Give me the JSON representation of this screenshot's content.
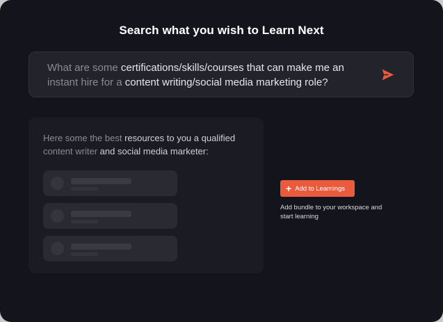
{
  "title": "Search what you wish to Learn Next",
  "search": {
    "query_segments": [
      {
        "text": "What are some ",
        "muted": true
      },
      {
        "text": "certifications/skills/courses that can make me an",
        "muted": false
      },
      {
        "text": " instant hire for a ",
        "muted": true
      },
      {
        "text": "content writing/social media marketing role?",
        "muted": false
      }
    ],
    "send_icon": "send-icon",
    "accent_color": "#ea5b3e"
  },
  "result": {
    "text_segments": [
      {
        "text": "Here some the best ",
        "muted": true
      },
      {
        "text": "resources to you a qualified",
        "muted": false
      },
      {
        "text": " content writer ",
        "muted": true
      },
      {
        "text": "and social media marketer:",
        "muted": false
      }
    ],
    "placeholder_items": 3
  },
  "action": {
    "button_label": "Add to Learnings",
    "button_icon": "plus-icon",
    "hint": "Add bundle to your workspace and start learning"
  }
}
